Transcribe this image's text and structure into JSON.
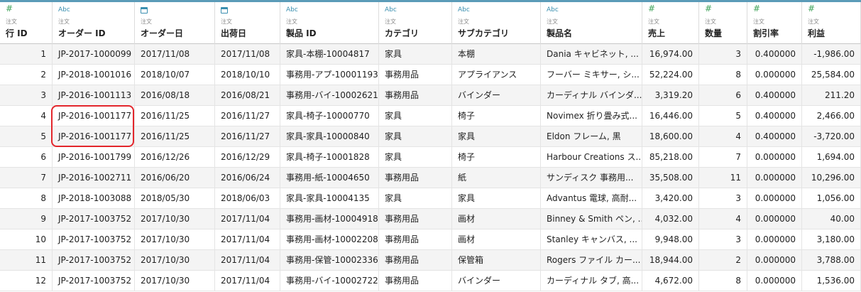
{
  "columns": [
    {
      "key": "row_id",
      "type_icon": "#",
      "type_kind": "num",
      "source": "注文",
      "name": "行 ID"
    },
    {
      "key": "order_id",
      "type_icon": "Abc",
      "type_kind": "str",
      "source": "注文",
      "name": "オーダー ID"
    },
    {
      "key": "order_date",
      "type_icon": "calendar",
      "type_kind": "date",
      "source": "注文",
      "name": "オーダー日"
    },
    {
      "key": "ship_date",
      "type_icon": "calendar",
      "type_kind": "date",
      "source": "注文",
      "name": "出荷日"
    },
    {
      "key": "product_id",
      "type_icon": "Abc",
      "type_kind": "str",
      "source": "注文",
      "name": "製品 ID"
    },
    {
      "key": "category",
      "type_icon": "Abc",
      "type_kind": "str",
      "source": "注文",
      "name": "カテゴリ"
    },
    {
      "key": "subcategory",
      "type_icon": "Abc",
      "type_kind": "str",
      "source": "注文",
      "name": "サブカテゴリ"
    },
    {
      "key": "product_name",
      "type_icon": "Abc",
      "type_kind": "str",
      "source": "注文",
      "name": "製品名"
    },
    {
      "key": "sales",
      "type_icon": "#",
      "type_kind": "num",
      "source": "注文",
      "name": "売上"
    },
    {
      "key": "quantity",
      "type_icon": "#",
      "type_kind": "num",
      "source": "注文",
      "name": "数量"
    },
    {
      "key": "discount",
      "type_icon": "#",
      "type_kind": "num",
      "source": "注文",
      "name": "割引率"
    },
    {
      "key": "profit",
      "type_icon": "#",
      "type_kind": "num",
      "source": "注文",
      "name": "利益"
    }
  ],
  "rows": [
    [
      "1",
      "JP-2017-1000099",
      "2017/11/08",
      "2017/11/08",
      "家具-本棚-10004817",
      "家具",
      "本棚",
      "Dania キャビネット, ...",
      "16,974.00",
      "3",
      "0.400000",
      "-1,986.00"
    ],
    [
      "2",
      "JP-2018-1001016",
      "2018/10/07",
      "2018/10/10",
      "事務用-アプ-10001193",
      "事務用品",
      "アプライアンス",
      "フーバー ミキサー, シ...",
      "52,224.00",
      "8",
      "0.000000",
      "25,584.00"
    ],
    [
      "3",
      "JP-2016-1001113",
      "2016/08/18",
      "2016/08/21",
      "事務用-バイ-10002621",
      "事務用品",
      "バインダー",
      "カーディナル バインダ...",
      "3,319.20",
      "6",
      "0.400000",
      "211.20"
    ],
    [
      "4",
      "JP-2016-1001177",
      "2016/11/25",
      "2016/11/27",
      "家具-椅子-10000770",
      "家具",
      "椅子",
      "Novimex 折り畳み式...",
      "16,446.00",
      "5",
      "0.400000",
      "2,466.00"
    ],
    [
      "5",
      "JP-2016-1001177",
      "2016/11/25",
      "2016/11/27",
      "家具-家具-10000840",
      "家具",
      "家具",
      "Eldon フレーム, 黒",
      "18,600.00",
      "4",
      "0.400000",
      "-3,720.00"
    ],
    [
      "6",
      "JP-2016-1001799",
      "2016/12/26",
      "2016/12/29",
      "家具-椅子-10001828",
      "家具",
      "椅子",
      "Harbour Creations ス...",
      "85,218.00",
      "7",
      "0.000000",
      "1,694.00"
    ],
    [
      "7",
      "JP-2016-1002711",
      "2016/06/20",
      "2016/06/24",
      "事務用-紙-10004650",
      "事務用品",
      "紙",
      "サンディスク 事務用...",
      "35,508.00",
      "11",
      "0.000000",
      "10,296.00"
    ],
    [
      "8",
      "JP-2018-1003088",
      "2018/05/30",
      "2018/06/03",
      "家具-家具-10004135",
      "家具",
      "家具",
      "Advantus 電球, 高耐...",
      "3,420.00",
      "3",
      "0.000000",
      "1,056.00"
    ],
    [
      "9",
      "JP-2017-1003752",
      "2017/10/30",
      "2017/11/04",
      "事務用-画材-10004918",
      "事務用品",
      "画材",
      "Binney & Smith ペン, ...",
      "4,032.00",
      "4",
      "0.000000",
      "40.00"
    ],
    [
      "10",
      "JP-2017-1003752",
      "2017/10/30",
      "2017/11/04",
      "事務用-画材-10002208",
      "事務用品",
      "画材",
      "Stanley キャンバス, ...",
      "9,948.00",
      "3",
      "0.000000",
      "3,180.00"
    ],
    [
      "11",
      "JP-2017-1003752",
      "2017/10/30",
      "2017/11/04",
      "事務用-保管-10002336",
      "事務用品",
      "保管箱",
      "Rogers ファイル カー...",
      "18,944.00",
      "2",
      "0.000000",
      "3,788.00"
    ],
    [
      "12",
      "JP-2017-1003752",
      "2017/10/30",
      "2017/11/04",
      "事務用-バイ-10002722",
      "事務用品",
      "バインダー",
      "カーディナル タブ, 高...",
      "4,672.00",
      "8",
      "0.000000",
      "1,536.00"
    ]
  ],
  "highlight": {
    "color": "#e3262c",
    "target_column": "order_id",
    "target_rows": [
      4,
      5
    ]
  },
  "colors": {
    "accent_top_border": "#5b9bb8",
    "number_icon": "#3fa35a",
    "string_icon": "#3a8fb0",
    "alt_row": "#f4f4f4"
  }
}
